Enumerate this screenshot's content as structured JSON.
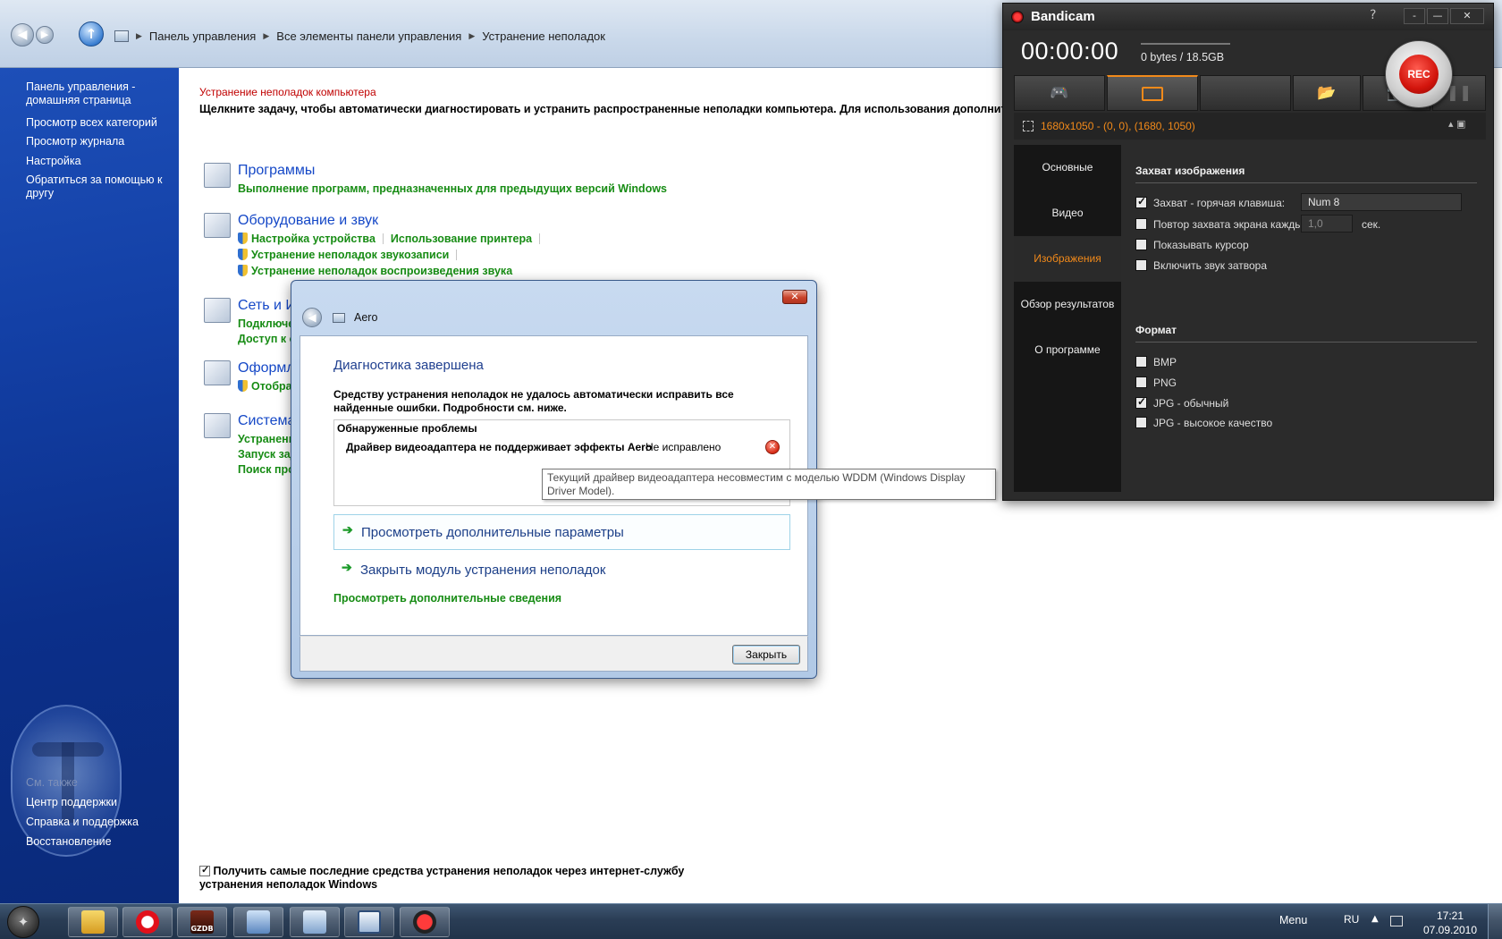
{
  "explorer": {
    "breadcrumb": [
      "Панель управления",
      "Все элементы панели управления",
      "Устранение неполадок"
    ],
    "left_links": [
      "Панель управления - домашняя страница",
      "Просмотр всех категорий",
      "Просмотр журнала",
      "Настройка",
      "Обратиться за помощью к другу"
    ],
    "see_also": "См. также",
    "see_also_links": [
      "Центр поддержки",
      "Справка и поддержка",
      "Восстановление"
    ],
    "subtitle": "Устранение неполадок компьютера",
    "description": "Щелкните задачу, чтобы автоматически диагностировать и устранить распространенные неполадки компьютера. Для использования дополнительных ср",
    "categories": [
      {
        "title": "Программы",
        "links": [
          "Выполнение программ, предназначенных для предыдущих версий Windows"
        ]
      },
      {
        "title": "Оборудование и звук",
        "links": [
          "Настройка устройства",
          "Использование принтера",
          "Устранение неполадок звукозаписи",
          "Устранение неполадок воспроизведения звука"
        ]
      },
      {
        "title": "Сеть и И",
        "links": [
          "Подключе",
          "Доступ к с"
        ]
      },
      {
        "title": "Оформл",
        "links": [
          "Отобра"
        ]
      },
      {
        "title": "Система",
        "links": [
          "Устранени",
          "Запуск зад",
          "Поиск про"
        ]
      }
    ],
    "footer_checkbox": "Получить самые последние средства устранения неполадок через интернет-службу устранения неполадок Windows"
  },
  "dialog": {
    "title": "Aero",
    "close_glyph": "✕",
    "heading": "Диагностика завершена",
    "message": "Средству устранения неполадок не удалось автоматически исправить все найденные ошибки. Подробности см. ниже.",
    "problems_header": "Обнаруженные проблемы",
    "problem": "Драйвер видеоадаптера не поддерживает эффекты Aero",
    "problem_status": "Не исправлено",
    "option_view": "Просмотреть дополнительные параметры",
    "option_close": "Закрыть модуль устранения неполадок",
    "more_info": "Просмотреть дополнительные сведения",
    "close_button": "Закрыть"
  },
  "tooltip": "Текущий драйвер видеоадаптера несовместим с моделью WDDM (Windows Display Driver Model).",
  "bandicam": {
    "title": "Bandicam",
    "help": "?",
    "win_buttons": [
      "-",
      "—",
      "✕"
    ],
    "timer": "00:00:00",
    "size": "0 bytes / 18.5GB",
    "rec": "REC",
    "region": "1680x1050 - (0, 0), (1680, 1050)",
    "sidebar": [
      "Основные",
      "Видео",
      "Изображения",
      "Обзор результатов",
      "О программе"
    ],
    "active_sidebar": "Изображения",
    "capture_header": "Захват изображения",
    "capture_options": [
      {
        "label": "Захват - горячая клавиша:",
        "checked": true
      },
      {
        "label": "Повтор захвата экрана каждые",
        "checked": false
      },
      {
        "label": "Показывать курсор",
        "checked": false
      },
      {
        "label": "Включить звук затвора",
        "checked": false
      }
    ],
    "hotkey_value": "Num 8",
    "repeat_value": "1,0",
    "repeat_unit": "сек.",
    "format_header": "Формат",
    "formats": [
      {
        "label": "BMP",
        "checked": false
      },
      {
        "label": "PNG",
        "checked": false
      },
      {
        "label": "JPG - обычный",
        "checked": true
      },
      {
        "label": "JPG - высокое качество",
        "checked": false
      }
    ]
  },
  "taskbar": {
    "menu_label": "Menu",
    "lang": "RU",
    "time": "17:21",
    "date": "07.09.2010",
    "gzdb_label": "GZDB"
  },
  "colors": {
    "link_green": "#178c14",
    "link_blue": "#1548c7",
    "accent_orange": "#f28a1a",
    "rec_red": "#d2140c"
  }
}
